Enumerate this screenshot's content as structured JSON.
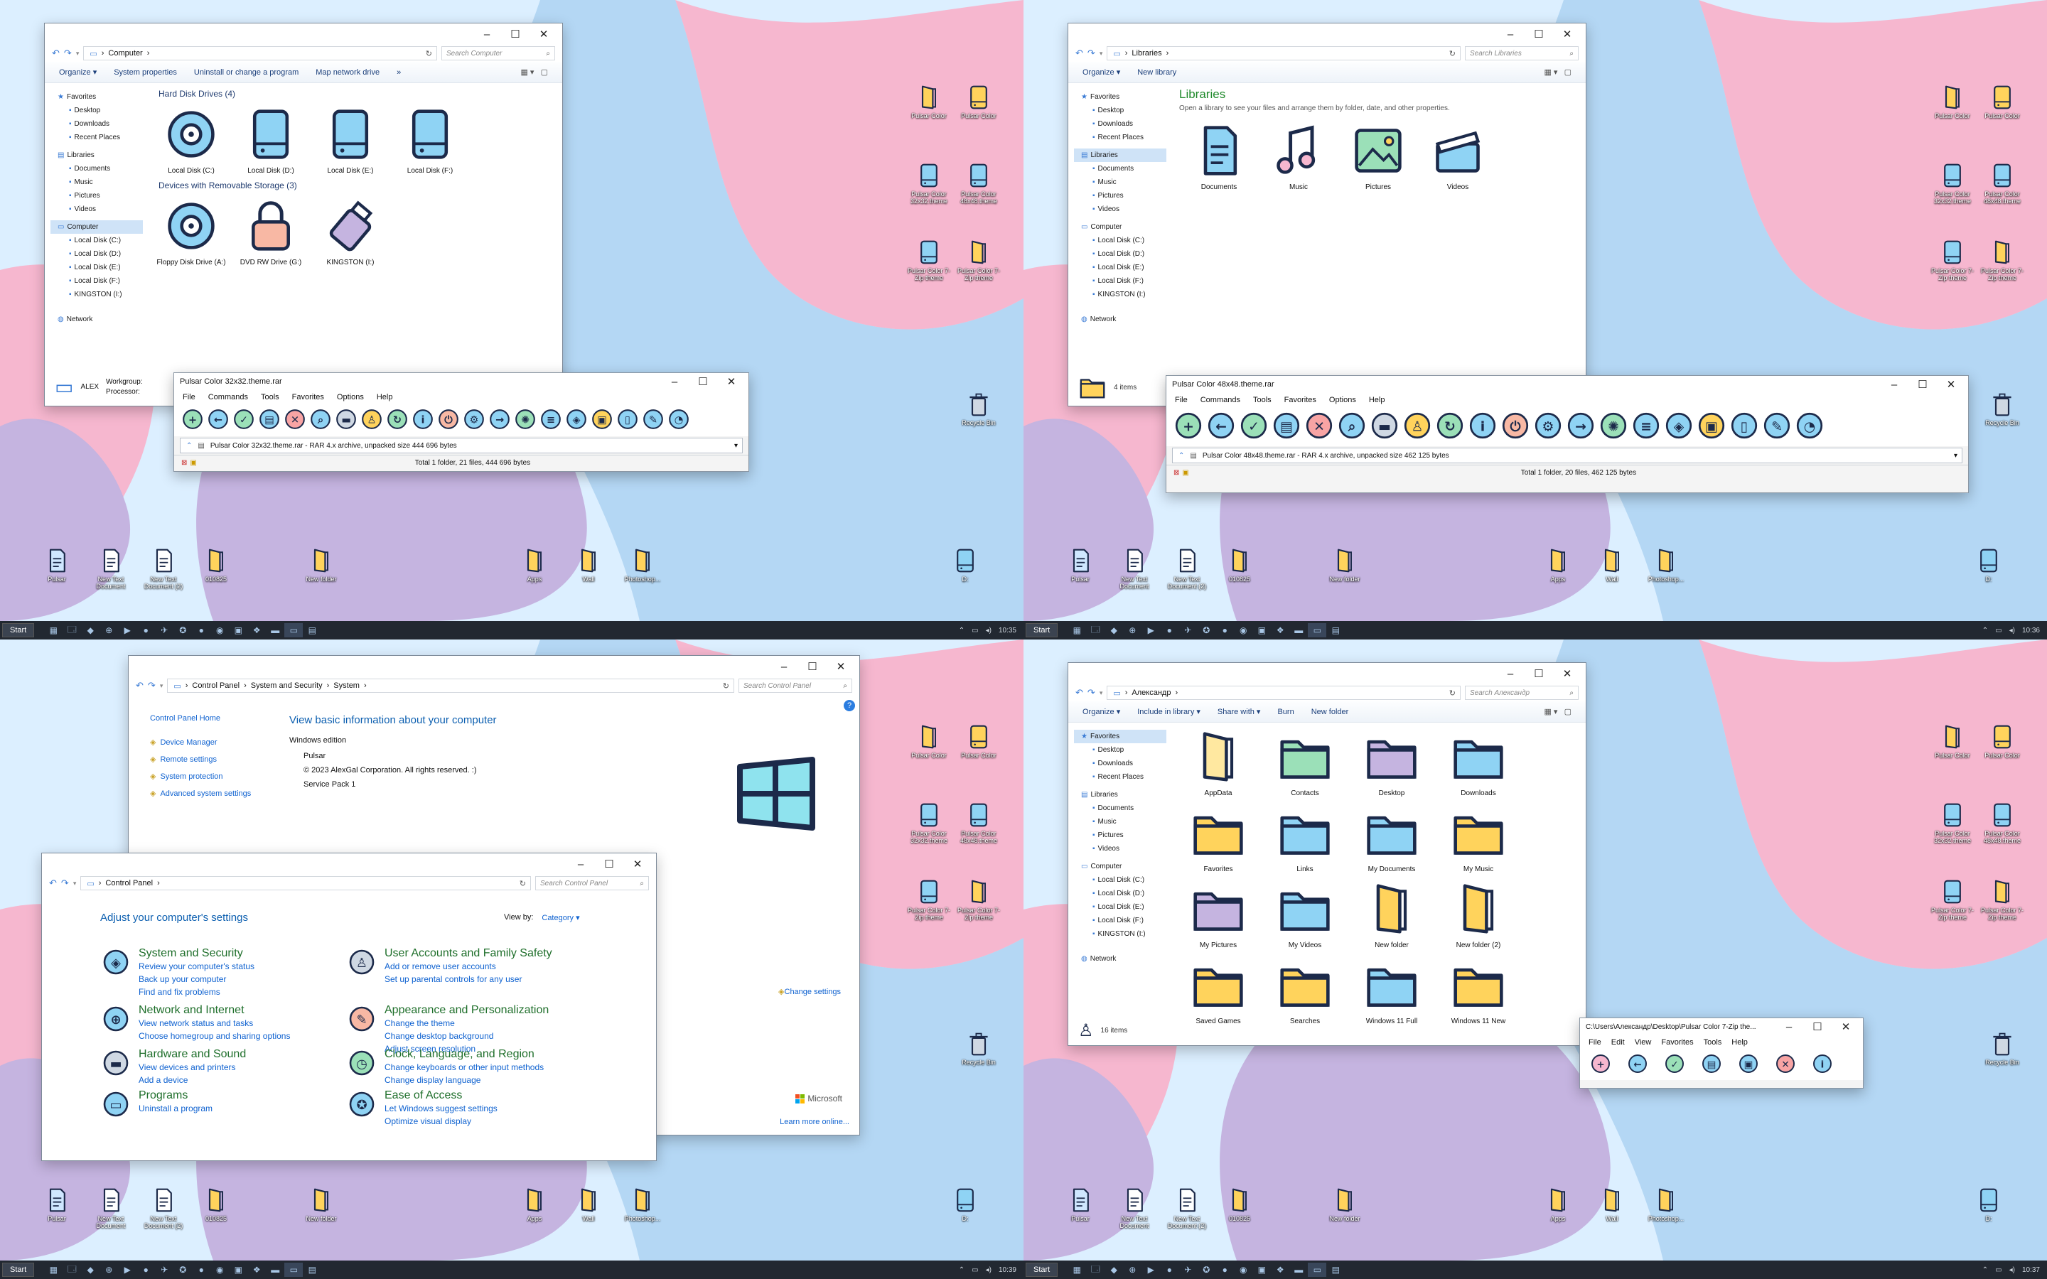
{
  "colors": {
    "wall_pink": "#f6b7cf",
    "wall_blue": "#a7cff0",
    "wall_lilac": "#c5b4e0",
    "wall_light": "#dcefff",
    "accent": "#3a7bd5",
    "ink": "#1c2a4a"
  },
  "taskbar": {
    "start": "Start",
    "times": [
      "10:35",
      "10:36",
      "10:39",
      "10:37"
    ]
  },
  "desktop_icons": {
    "right": [
      "Pulsar Color",
      "Pulsar Color",
      "Pulsar Color 32x32.theme",
      "Pulsar Color 48x48.theme",
      "Pulsar Color 7-Zip theme",
      "Pulsar Color 7-Zip theme",
      "Recycle Bin"
    ],
    "bottom": [
      "Pulsar",
      "New Text Document",
      "New Text Document (2)",
      "010825",
      "New folder",
      "Apps",
      "Wall",
      "Photoshop...",
      "D:"
    ]
  },
  "q1": {
    "explorer": {
      "address": [
        "Computer"
      ],
      "search": "Search Computer",
      "commands": [
        "Organize ▾",
        "System properties",
        "Uninstall or change a program",
        "Map network drive",
        "»"
      ],
      "nav": {
        "favorites": "Favorites",
        "fav_items": [
          "Desktop",
          "Downloads",
          "Recent Places"
        ],
        "libraries": "Libraries",
        "lib_items": [
          "Documents",
          "Music",
          "Pictures",
          "Videos"
        ],
        "computer": "Computer",
        "comp_items": [
          "Local Disk (C:)",
          "Local Disk (D:)",
          "Local Disk (E:)",
          "Local Disk (F:)",
          "KINGSTON (I:)"
        ],
        "network": "Network"
      },
      "group1": "Hard Disk Drives (4)",
      "drives": [
        "Local Disk (C:)",
        "Local Disk (D:)",
        "Local Disk (E:)",
        "Local Disk (F:)"
      ],
      "group2": "Devices with Removable Storage (3)",
      "removable": [
        "Floppy Disk Drive (A:)",
        "DVD RW Drive (G:)",
        "KINGSTON (I:)"
      ],
      "details": {
        "name": "ALEX",
        "workgroup": "Workgroup:",
        "processor": "Processor:"
      }
    },
    "rar": {
      "title": "Pulsar Color 32x32.theme.rar",
      "menu": [
        "File",
        "Commands",
        "Tools",
        "Favorites",
        "Options",
        "Help"
      ],
      "path": "Pulsar Color 32x32.theme.rar - RAR 4.x archive, unpacked size 444 696 bytes",
      "status": "Total 1 folder, 21 files, 444 696 bytes"
    }
  },
  "q2": {
    "explorer": {
      "address": [
        "Libraries"
      ],
      "search": "Search Libraries",
      "commands": [
        "Organize ▾",
        "New library"
      ],
      "title": "Libraries",
      "subtitle": "Open a library to see your files and arrange them by folder, date, and other properties.",
      "items": [
        "Documents",
        "Music",
        "Pictures",
        "Videos"
      ],
      "status": "4 items"
    },
    "rar": {
      "title": "Pulsar Color 48x48.theme.rar",
      "menu": [
        "File",
        "Commands",
        "Tools",
        "Favorites",
        "Options",
        "Help"
      ],
      "path": "Pulsar Color 48x48.theme.rar - RAR 4.x archive, unpacked size 462 125 bytes",
      "status": "Total 1 folder, 20 files, 462 125 bytes"
    }
  },
  "q3": {
    "system": {
      "address": [
        "Control Panel",
        "System and Security",
        "System"
      ],
      "search": "Search Control Panel",
      "side": [
        "Control Panel Home",
        "Device Manager",
        "Remote settings",
        "System protection",
        "Advanced system settings"
      ],
      "heading": "View basic information about your computer",
      "edition_label": "Windows edition",
      "edition": "Pulsar",
      "copyright": "© 2023 AlexGal Corporation. All rights reserved. :)",
      "sp": "Service Pack 1",
      "change": "Change settings",
      "ms": "Microsoft",
      "learn": "Learn more online..."
    },
    "cp": {
      "address": [
        "Control Panel"
      ],
      "search": "Search Control Panel",
      "heading": "Adjust your computer's settings",
      "viewby": "View by:",
      "category": "Category ▾",
      "cats": [
        {
          "t": "System and Security",
          "s": [
            "Review your computer's status",
            "Back up your computer",
            "Find and fix problems"
          ]
        },
        {
          "t": "Network and Internet",
          "s": [
            "View network status and tasks",
            "Choose homegroup and sharing options"
          ]
        },
        {
          "t": "Hardware and Sound",
          "s": [
            "View devices and printers",
            "Add a device"
          ]
        },
        {
          "t": "Programs",
          "s": [
            "Uninstall a program"
          ]
        },
        {
          "t": "User Accounts and Family Safety",
          "s": [
            "Add or remove user accounts",
            "Set up parental controls for any user"
          ]
        },
        {
          "t": "Appearance and Personalization",
          "s": [
            "Change the theme",
            "Change desktop background",
            "Adjust screen resolution"
          ]
        },
        {
          "t": "Clock, Language, and Region",
          "s": [
            "Change keyboards or other input methods",
            "Change display language"
          ]
        },
        {
          "t": "Ease of Access",
          "s": [
            "Let Windows suggest settings",
            "Optimize visual display"
          ]
        }
      ]
    }
  },
  "q4": {
    "explorer": {
      "address": [
        "Александр"
      ],
      "search": "Search Александр",
      "commands": [
        "Organize ▾",
        "Include in library ▾",
        "Share with ▾",
        "Burn",
        "New folder"
      ],
      "folders": [
        "AppData",
        "Contacts",
        "Desktop",
        "Downloads",
        "Favorites",
        "Links",
        "My Documents",
        "My Music",
        "My Pictures",
        "My Videos",
        "New folder",
        "New folder (2)",
        "Saved Games",
        "Searches",
        "Windows 11 Full",
        "Windows 11 New"
      ],
      "status": "16 items"
    },
    "zip": {
      "title": "C:\\Users\\Александр\\Desktop\\Pulsar Color  7-Zip the...",
      "menu": [
        "File",
        "Edit",
        "View",
        "Favorites",
        "Tools",
        "Help"
      ]
    }
  }
}
